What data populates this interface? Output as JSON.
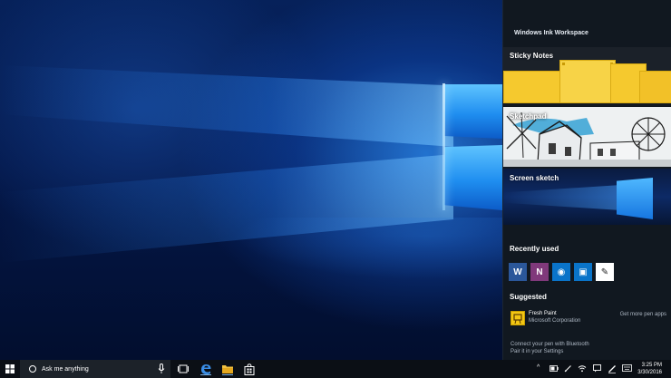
{
  "ink_workspace": {
    "title": "Windows Ink Workspace",
    "sticky_notes_label": "Sticky Notes",
    "sketchpad_label": "Sketchpad",
    "screen_sketch_label": "Screen sketch",
    "recently_used_heading": "Recently used",
    "recent_apps": [
      {
        "name": "word-app",
        "glyph": "W",
        "color": "#2b579a"
      },
      {
        "name": "onenote-app",
        "glyph": "N",
        "color": "#80397b"
      },
      {
        "name": "maps-app",
        "glyph": "◉",
        "color": "#0a74c9"
      },
      {
        "name": "photos-app",
        "glyph": "▣",
        "color": "#0a74c9"
      },
      {
        "name": "ink-app",
        "glyph": "✎",
        "color": "#ffffff"
      }
    ],
    "suggested_heading": "Suggested",
    "suggested_app": {
      "name": "Fresh Paint",
      "publisher": "Microsoft Corporation"
    },
    "get_more_link": "Get more pen apps",
    "bluetooth_line1": "Connect your pen with Bluetooth",
    "bluetooth_line2": "Pair it in your Settings"
  },
  "taskbar": {
    "search_placeholder": "Ask me anything",
    "clock_time": "3:25 PM",
    "clock_date": "3/30/2016"
  },
  "colors": {
    "accent": "#0a74c9",
    "sticky_yellow": "#f5c92e",
    "panel_bg": "#111820",
    "taskbar_bg": "#0b0f15"
  }
}
